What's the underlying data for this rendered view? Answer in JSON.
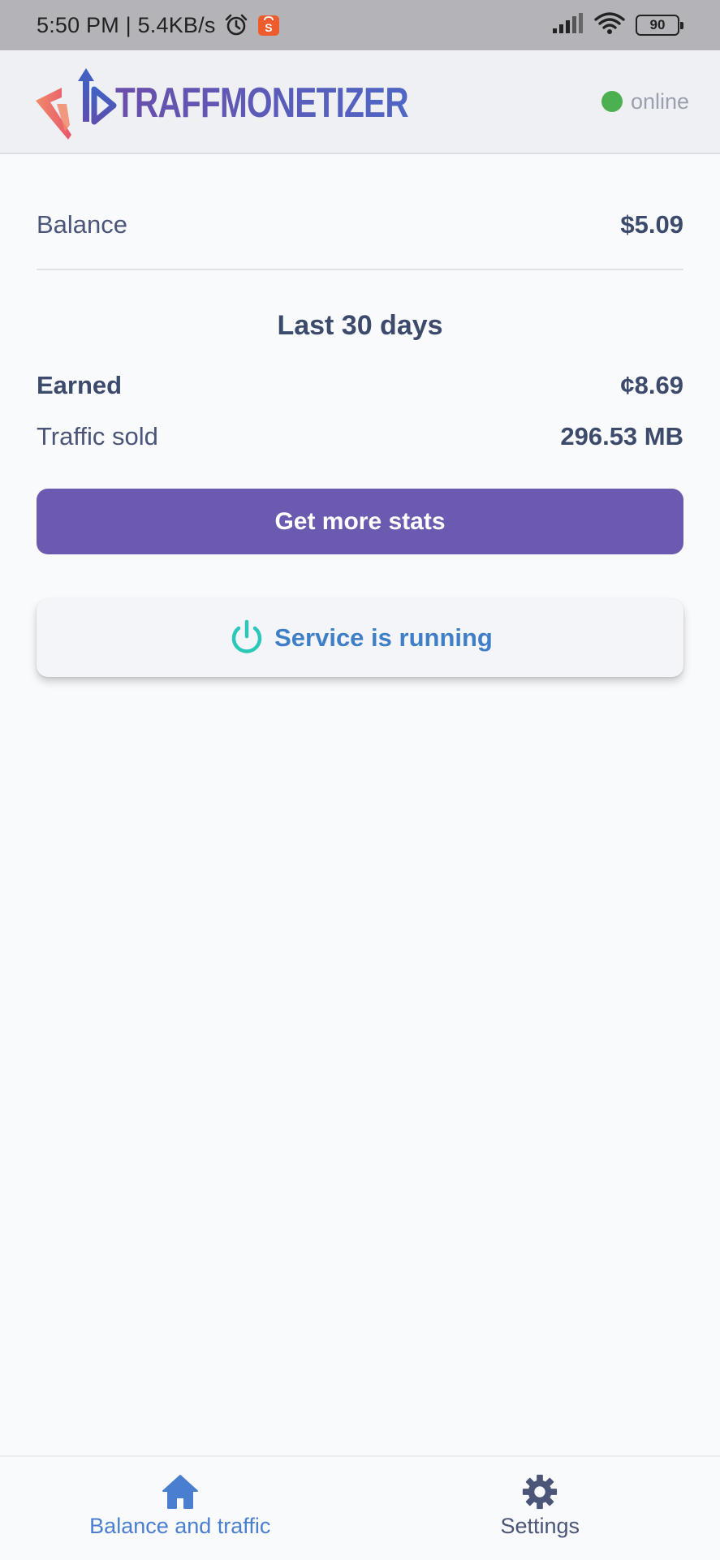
{
  "status_bar": {
    "time_speed": "5:50 PM | 5.4KB/s",
    "battery": "90",
    "icons": [
      "alarm-icon",
      "shopee-icon",
      "signal-icon",
      "wifi-icon",
      "battery-icon"
    ]
  },
  "header": {
    "app_name": "TRAFFMONETIZER",
    "status": "online",
    "status_color": "#4caf50"
  },
  "balance": {
    "label": "Balance",
    "value": "$5.09"
  },
  "last_30_days": {
    "title": "Last 30 days",
    "earned_label": "Earned",
    "earned_value": "¢8.69",
    "traffic_label": "Traffic sold",
    "traffic_value": "296.53 MB"
  },
  "stats_button": {
    "label": "Get more stats",
    "color": "#6c59b0"
  },
  "service": {
    "status_text": "Service is running",
    "icon": "power-icon"
  },
  "bottom_nav": {
    "items": [
      {
        "label": "Balance and traffic",
        "icon": "home-icon",
        "active": true
      },
      {
        "label": "Settings",
        "icon": "gear-icon",
        "active": false
      }
    ]
  },
  "colors": {
    "accent": "#4a7fd0",
    "primary": "#6c59b0",
    "power_icon": "#2cc7b8"
  }
}
